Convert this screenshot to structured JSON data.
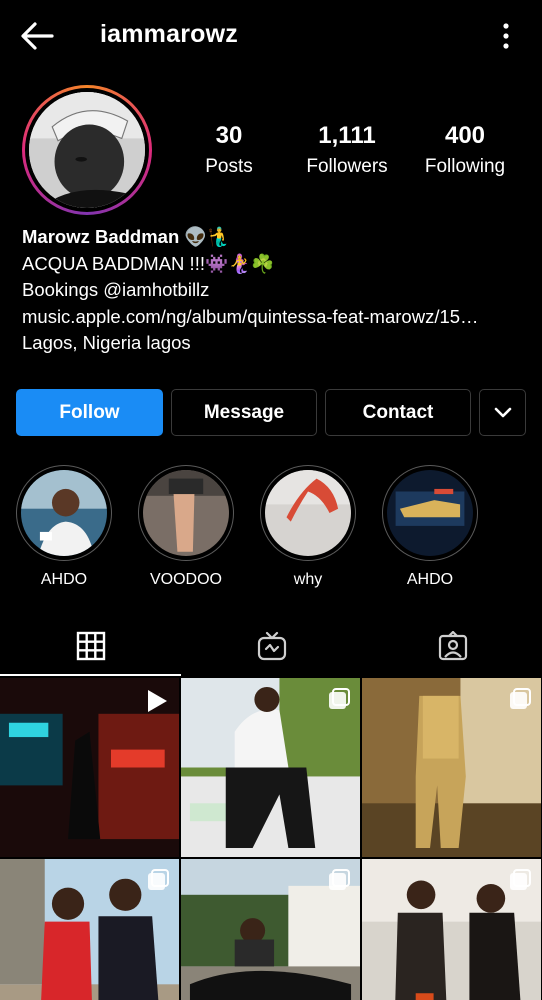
{
  "header": {
    "username": "iammarowz",
    "back_icon": "arrow-left-icon",
    "menu_icon": "more-vertical-icon"
  },
  "stats": {
    "posts_count": "30",
    "posts_label": "Posts",
    "followers_count": "1,111",
    "followers_label": "Followers",
    "following_count": "400",
    "following_label": "Following"
  },
  "bio": {
    "name": "Marowz Baddman 👽🧜‍♂️",
    "line1": "ACQUA BADDMAN !!!👾🧜‍♀️☘️",
    "line2": "Bookings @iamhotbillz",
    "link": "music.apple.com/ng/album/quintessa-feat-marowz/15…",
    "location": "Lagos, Nigeria lagos"
  },
  "actions": {
    "follow_label": "Follow",
    "message_label": "Message",
    "contact_label": "Contact",
    "more_icon": "chevron-down-icon"
  },
  "highlights": [
    {
      "label": "AHDO"
    },
    {
      "label": "VOODOO"
    },
    {
      "label": "why"
    },
    {
      "label": "AHDO"
    }
  ],
  "tabs": [
    {
      "name": "grid",
      "icon": "grid-icon",
      "active": true
    },
    {
      "name": "igtv",
      "icon": "igtv-icon",
      "active": false
    },
    {
      "name": "tagged",
      "icon": "tagged-icon",
      "active": false
    }
  ],
  "colors": {
    "background": "#000000",
    "follow_button": "#1a8cf5",
    "outline_button_border": "#3a3a3a"
  }
}
